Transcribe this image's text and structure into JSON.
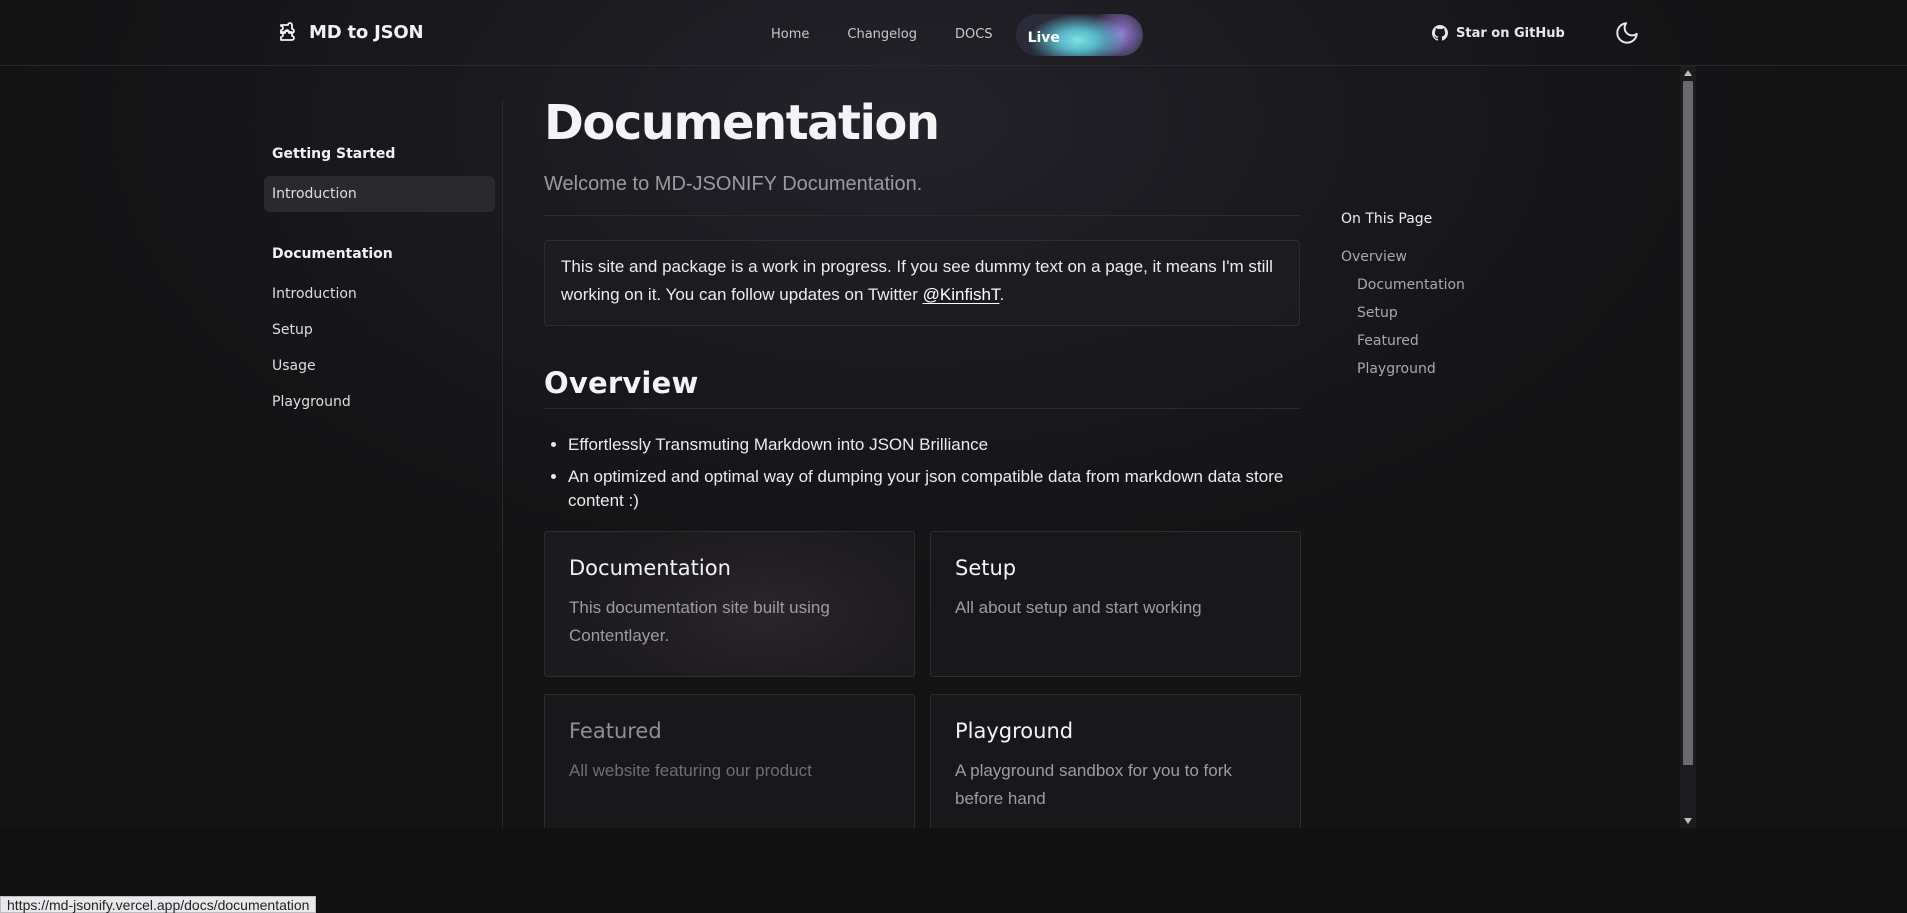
{
  "header": {
    "brand": "MD to JSON",
    "nav": [
      "Home",
      "Changelog",
      "DOCS",
      "Live"
    ],
    "github_label": "Star on GitHub"
  },
  "sidebar": {
    "sections": [
      {
        "title": "Getting Started",
        "items": [
          {
            "label": "Introduction",
            "active": true
          }
        ]
      },
      {
        "title": "Documentation",
        "items": [
          {
            "label": "Introduction"
          },
          {
            "label": "Setup"
          },
          {
            "label": "Usage"
          },
          {
            "label": "Playground"
          }
        ]
      }
    ]
  },
  "main": {
    "title": "Documentation",
    "lede": "Welcome to MD-JSONIFY Documentation.",
    "note_text": "This site and package is a work in progress. If you see dummy text on a page, it means I'm still working on it. You can follow updates on Twitter ",
    "note_link": "@KinfishT",
    "note_end": ".",
    "overview_heading": "Overview",
    "bullets": [
      "Effortlessly Transmuting Markdown into JSON Brilliance",
      "An optimized and optimal way of dumping your json compatible data from markdown data store content :)"
    ],
    "cards": [
      {
        "title": "Documentation",
        "desc": "This documentation site built using Contentlayer."
      },
      {
        "title": "Setup",
        "desc": "All about setup and start working"
      },
      {
        "title": "Featured",
        "desc": "All website featuring our product"
      },
      {
        "title": "Playground",
        "desc": "A playground sandbox for you to fork before hand"
      }
    ]
  },
  "toc": {
    "title": "On This Page",
    "items": [
      "Overview",
      "Documentation",
      "Setup",
      "Featured",
      "Playground"
    ]
  },
  "status_url": "https://md-jsonify.vercel.app/docs/documentation"
}
